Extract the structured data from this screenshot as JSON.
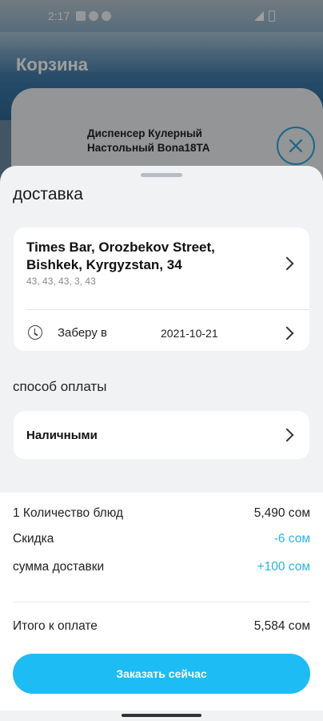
{
  "status_bar": {
    "time": "2:17"
  },
  "page": {
    "title": "Корзина"
  },
  "cart": {
    "item_name": "Диспенсер Кулерный Настольный Bona18TA"
  },
  "sheet": {
    "title": "доставка",
    "address": {
      "main": "Times Bar, Orozbekov Street, Bishkek, Kyrgyzstan, 34",
      "sub": "43, 43, 43, 3, 43"
    },
    "pickup": {
      "label": "Заберу в",
      "date": "2021-10-21"
    },
    "payment": {
      "title": "способ оплаты",
      "method": "Наличными"
    }
  },
  "summary": {
    "rows": [
      {
        "label": "1 Количество блюд",
        "value": "5,490 сом"
      },
      {
        "label": "Скидка",
        "value": "-6 сом"
      },
      {
        "label": "сумма доставки",
        "value": "+100 сом"
      }
    ],
    "total_label": "Итого к оплате",
    "total_value": "5,584 сом",
    "order_button": "Заказать сейчас"
  },
  "colors": {
    "accent": "#1ebcf5",
    "accent_text": "#2ab3e8"
  },
  "icons": [
    "clock-icon",
    "chevron-right-icon",
    "close-icon"
  ]
}
